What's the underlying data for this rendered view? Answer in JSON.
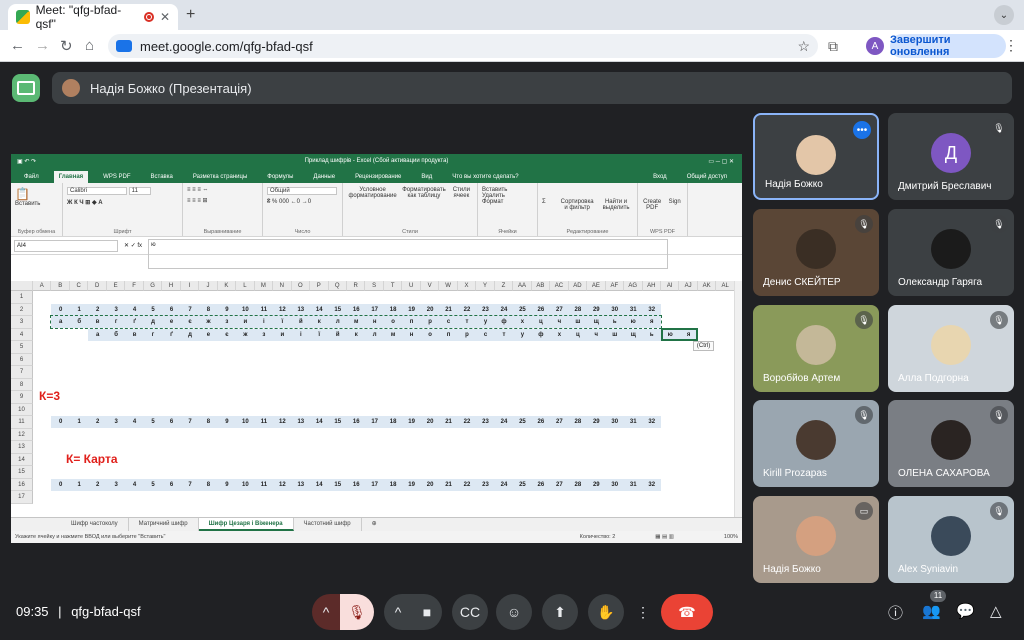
{
  "browser": {
    "tab_title": "Meet: \"qfg-bfad-qsf\"",
    "url": "meet.google.com/qfg-bfad-qsf",
    "avatar_letter": "A",
    "update_label": "Завершити оновлення"
  },
  "meet": {
    "presenter": "Надія Божко (Презентація)",
    "time": "09:35",
    "separator": "|",
    "meeting_code": "qfg-bfad-qsf",
    "participant_count": "11",
    "tiles": [
      {
        "name": "Надія Божко",
        "letter": ""
      },
      {
        "name": "Дмитрий Бреславич",
        "letter": "Д"
      },
      {
        "name": "Денис СКЕЙТЕР",
        "letter": ""
      },
      {
        "name": "Олександр Гаряга",
        "letter": ""
      },
      {
        "name": "Воробйов Артем",
        "letter": ""
      },
      {
        "name": "Алла Подгорна",
        "letter": ""
      },
      {
        "name": "Kirill Prozapas",
        "letter": ""
      },
      {
        "name": "ОЛЕНА САХАРОВА",
        "letter": ""
      },
      {
        "name": "Надія Божко",
        "letter": ""
      },
      {
        "name": "Alex Syniavin",
        "letter": ""
      }
    ]
  },
  "excel": {
    "title": "Приклад шифрів - Excel (Сбой активации продукта)",
    "login": "Вход",
    "share": "Общий доступ",
    "tabs": [
      "Файл",
      "Главная",
      "WPS PDF",
      "Вставка",
      "Разметка страницы",
      "Формулы",
      "Данные",
      "Рецензирование",
      "Вид",
      "Что вы хотите сделать?"
    ],
    "groups": [
      "Буфер обмена",
      "Шрифт",
      "Выравнивание",
      "Число",
      "Стили",
      "Ячейки",
      "Редактирование",
      "WPS PDF"
    ],
    "ribbon": {
      "paste": "Вставить",
      "font": "Calibri",
      "size": "11",
      "format": "Общий",
      "cond": "Условное форматирование",
      "table": "Форматировать как таблицу",
      "cellstyles": "Стили ячеек",
      "insert": "Вставить",
      "delete": "Удалить",
      "fmt": "Формат",
      "sort": "Сортировка и фильтр",
      "find": "Найти и выделить",
      "createpdf": "Create PDF",
      "sign": "Sign"
    },
    "namebox": "AI4",
    "formula": "ю",
    "columns": [
      "A",
      "B",
      "C",
      "D",
      "E",
      "F",
      "G",
      "H",
      "I",
      "J",
      "K",
      "L",
      "M",
      "N",
      "O",
      "P",
      "Q",
      "R",
      "S",
      "T",
      "U",
      "V",
      "W",
      "X",
      "Y",
      "Z",
      "AA",
      "AB",
      "AC",
      "AD",
      "AE",
      "AF",
      "AG",
      "AH",
      "AI",
      "AJ",
      "AK",
      "AL"
    ],
    "rows": [
      "1",
      "2",
      "3",
      "4",
      "5",
      "6",
      "7",
      "8",
      "9",
      "10",
      "11",
      "12",
      "13",
      "14",
      "15",
      "16",
      "17"
    ],
    "numbers": [
      "0",
      "1",
      "2",
      "3",
      "4",
      "5",
      "6",
      "7",
      "8",
      "9",
      "10",
      "11",
      "12",
      "13",
      "14",
      "15",
      "16",
      "17",
      "18",
      "19",
      "20",
      "21",
      "22",
      "23",
      "24",
      "25",
      "26",
      "27",
      "28",
      "29",
      "30",
      "31",
      "32"
    ],
    "alphabet": [
      "а",
      "б",
      "в",
      "г",
      "ґ",
      "д",
      "е",
      "є",
      "ж",
      "з",
      "и",
      "і",
      "ї",
      "й",
      "к",
      "л",
      "м",
      "н",
      "о",
      "п",
      "р",
      "с",
      "т",
      "у",
      "ф",
      "х",
      "ц",
      "ч",
      "ш",
      "щ",
      "ь",
      "ю",
      "я"
    ],
    "shifted": [
      "а",
      "б",
      "в",
      "г",
      "ґ",
      "д",
      "е",
      "є",
      "ж",
      "з",
      "и",
      "і",
      "ї",
      "й",
      "к",
      "л",
      "м",
      "н",
      "о",
      "п",
      "р",
      "с",
      "т",
      "у",
      "ф",
      "х",
      "ц",
      "ч",
      "ш",
      "щ",
      "ь",
      "ю",
      "я"
    ],
    "k3": "К=3",
    "kkarta": "К= Карта",
    "paste_opt": "(Ctrl)",
    "sheets": [
      "Шифр частоколу",
      "Матричний шифр",
      "Шифр Цезаря і Віженера",
      "Частотний шифр"
    ],
    "status_left": "Укажите ячейку и нажмите ВВОД или выберите \"Вставить\"",
    "status_count": "Количество: 2",
    "zoom": "100%"
  }
}
